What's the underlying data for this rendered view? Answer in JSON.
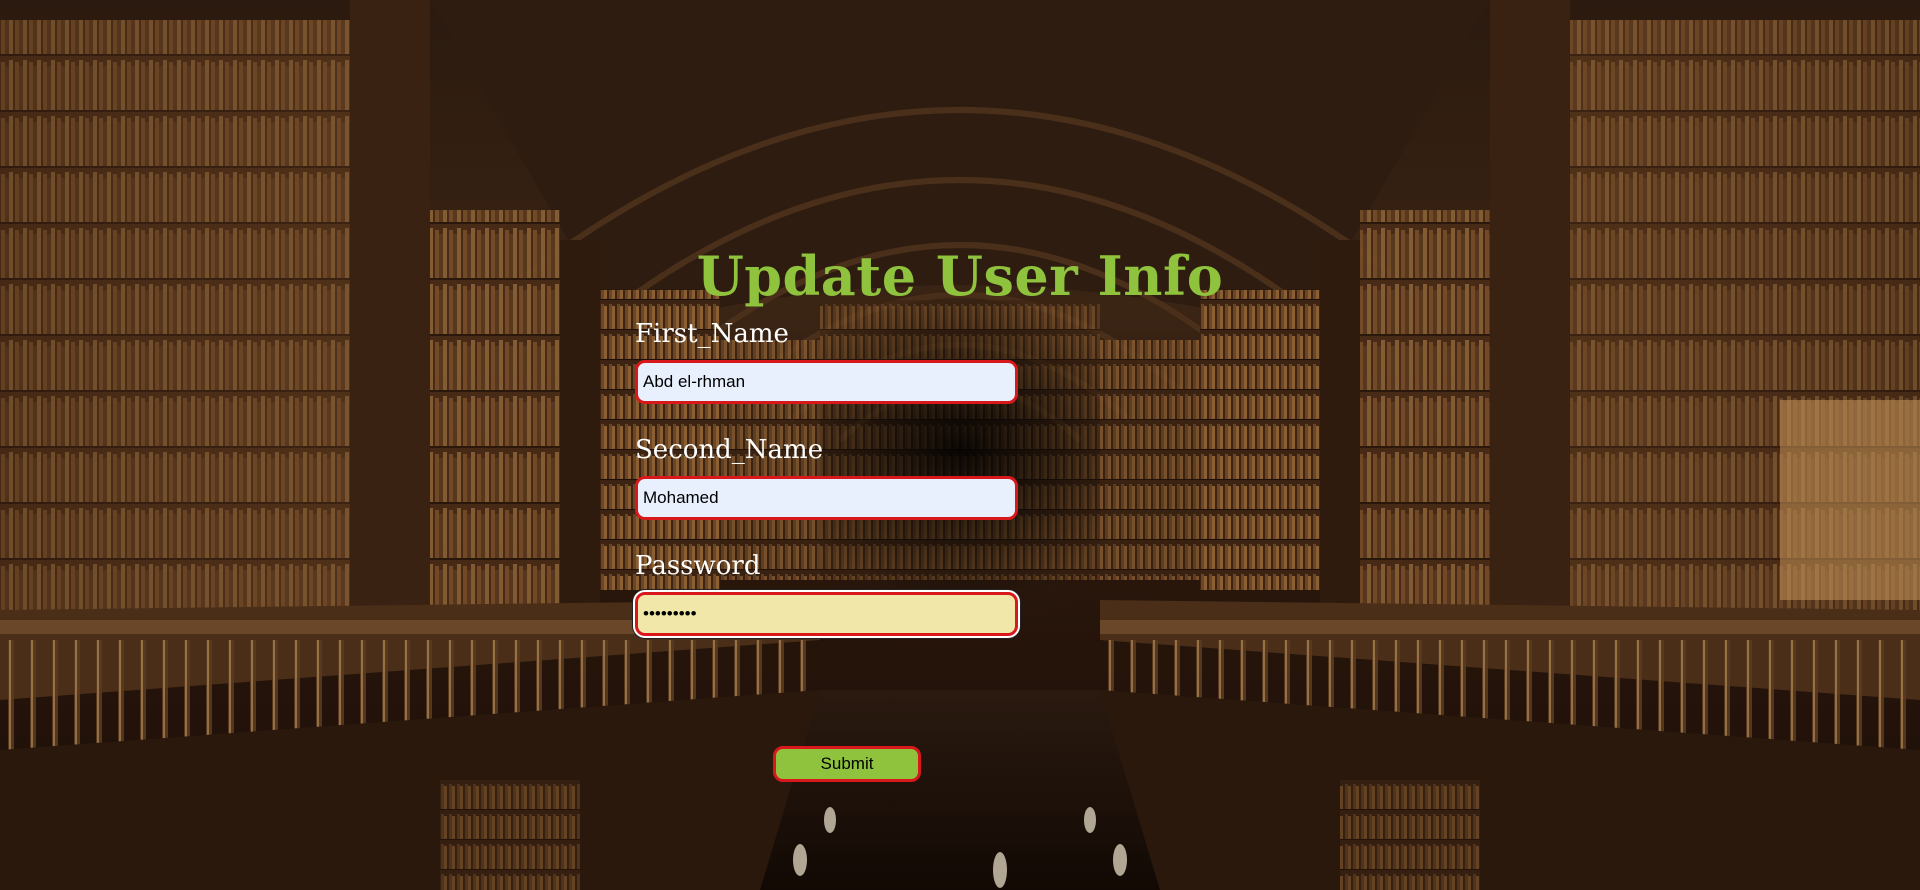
{
  "page": {
    "title": "Update User Info"
  },
  "form": {
    "fields": [
      {
        "label": "First_Name",
        "value": "Abd el-rhman",
        "type": "text"
      },
      {
        "label": "Second_Name",
        "value": "Mohamed",
        "type": "text"
      },
      {
        "label": "Password",
        "value": "*********",
        "type": "password"
      }
    ],
    "submit_label": "Submit"
  },
  "colors": {
    "title": "#8fc23d",
    "input_border": "#d9181c",
    "input_bg": "#e8f0fe",
    "focused_input_bg": "#f1e7a8",
    "submit_bg": "#8fc23d"
  }
}
